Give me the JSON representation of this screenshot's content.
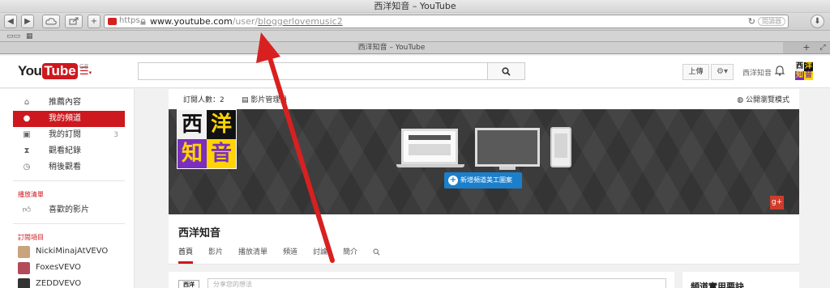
{
  "window": {
    "title": "西洋知音 – YouTube"
  },
  "toolbar": {
    "back_label": "◀",
    "forward_label": "▶",
    "url_protocol": "https",
    "url_host": "www.youtube.com",
    "url_path_prefix": "/user/",
    "url_path_user": "bloggerlovemusic2",
    "reload_icon": "reload-icon",
    "reader_label": "閱讀器"
  },
  "tabbar": {
    "tab_title": "西洋知音 – YouTube"
  },
  "header": {
    "logo_you": "You",
    "logo_tube": "Tube",
    "logo_region": "GB",
    "search_placeholder": "",
    "upload_label": "上傳",
    "user_name": "西洋知音"
  },
  "sidebar": {
    "items": [
      {
        "label": "推薦內容",
        "icon": "home-icon",
        "active": false,
        "count": ""
      },
      {
        "label": "我的頻道",
        "icon": "user-icon",
        "active": true,
        "count": ""
      },
      {
        "label": "我的訂閱",
        "icon": "subscriptions-icon",
        "active": false,
        "count": "3"
      },
      {
        "label": "觀看紀錄",
        "icon": "history-icon",
        "active": false,
        "count": ""
      },
      {
        "label": "稍後觀看",
        "icon": "clock-icon",
        "active": false,
        "count": ""
      }
    ],
    "playlists_title": "播放清單",
    "playlists": [
      {
        "label": "喜歡的影片",
        "icon": "thumbs-up-icon"
      }
    ],
    "subscriptions_title": "訂閱項目",
    "subscriptions": [
      {
        "label": "NickiMinajAtVEVO",
        "color": "#c9a27e"
      },
      {
        "label": "FoxesVEVO",
        "color": "#b34a5a"
      },
      {
        "label": "ZEDDVEVO",
        "color": "#333333"
      }
    ]
  },
  "channel": {
    "subscribers": "訂閱人數：2",
    "video_manager": "影片管理員",
    "public_view": "公開瀏覽模式",
    "art_chars": [
      "西",
      "洋",
      "知",
      "音"
    ],
    "add_art_button": "新增頻道美工圖案",
    "gplus": "g+",
    "name": "西洋知音",
    "tabs": [
      "首頁",
      "影片",
      "播放清單",
      "頻道",
      "討論",
      "簡介"
    ]
  },
  "feed": {
    "avatar_text": "西洋",
    "comment_placeholder": "分享您的想法",
    "side_title": "頻道實用要訣"
  },
  "colors": {
    "youtube_red": "#cc181e",
    "button_blue": "#1b7fcc",
    "annotation_red": "#d92020"
  }
}
